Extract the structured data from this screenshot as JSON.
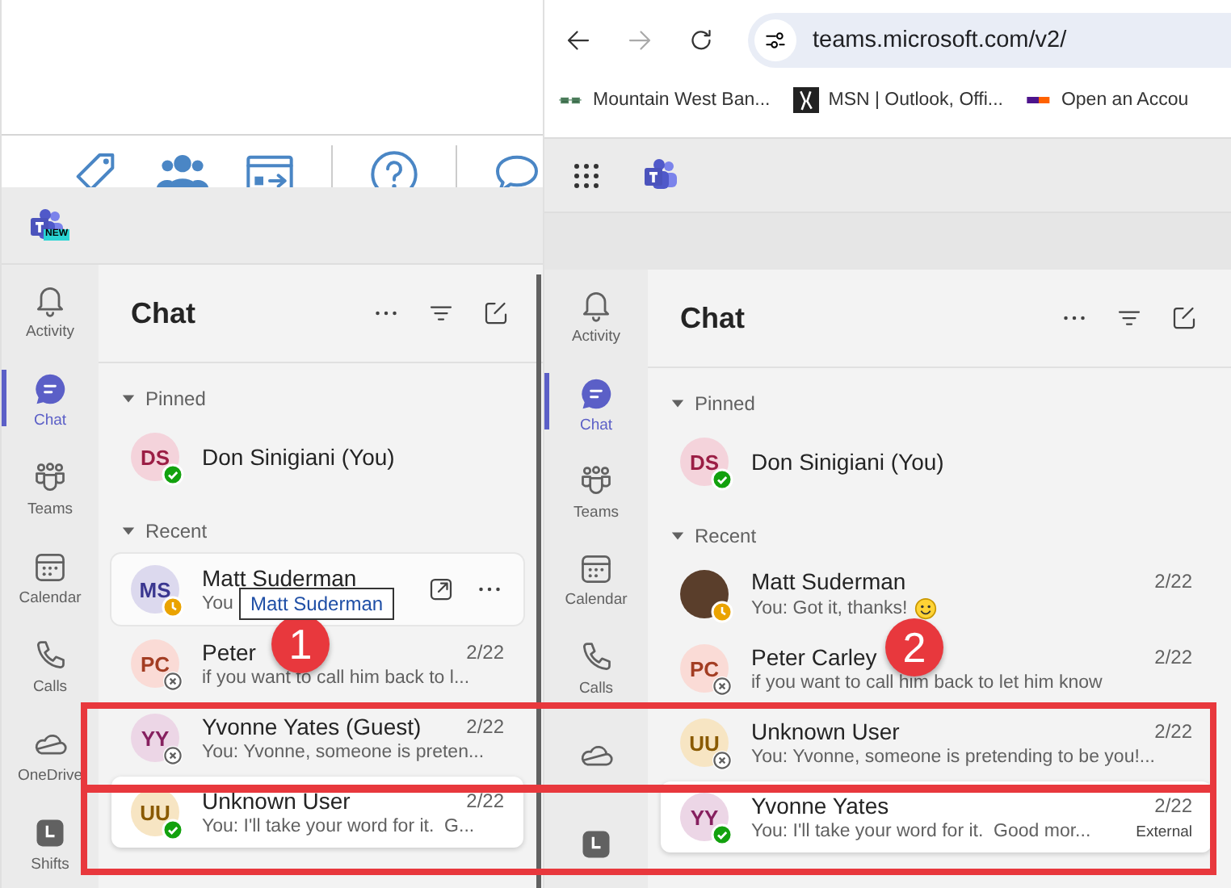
{
  "panes": [
    {
      "top": {
        "kind": "toolbar"
      },
      "app_bar": {
        "launcher": false,
        "logo_badge": "NEW"
      },
      "rail": [
        {
          "kind": "activity",
          "label": "Activity",
          "selected": false
        },
        {
          "kind": "chat",
          "label": "Chat",
          "selected": true
        },
        {
          "kind": "teams",
          "label": "Teams",
          "selected": false
        },
        {
          "kind": "calendar",
          "label": "Calendar",
          "selected": false
        },
        {
          "kind": "calls",
          "label": "Calls",
          "selected": false
        },
        {
          "kind": "onedrive",
          "label": "OneDrive",
          "selected": false
        },
        {
          "kind": "shifts",
          "label": "Shifts",
          "selected": false
        }
      ],
      "title": "Chat",
      "sections": [
        {
          "label": "Pinned",
          "expanded": true,
          "chats": [
            {
              "initials": "DS",
              "color": "#f4d3db",
              "name": "Don Sinigiani (You)",
              "presence": {
                "kind": "available"
              },
              "hovered": false,
              "selected": false
            }
          ]
        },
        {
          "label": "Recent",
          "expanded": true,
          "chats": [
            {
              "initials": "MS",
              "color": "#dcd9ee",
              "name": "Matt Suderman",
              "preview": "You",
              "presence": {
                "kind": "away"
              },
              "hovered": true,
              "selected": false,
              "tooltip": "Matt Suderman"
            },
            {
              "initials": "PC",
              "color": "#fadbd6",
              "name": "Peter",
              "date": "2/22",
              "preview": "if you want to call him back to l...",
              "presence": {
                "kind": "offline"
              },
              "hovered": false,
              "selected": false
            },
            {
              "initials": "YY",
              "color": "#ecd6e6",
              "name": "Yvonne Yates (Guest)",
              "date": "2/22",
              "preview": "You: Yvonne, someone is preten...",
              "presence": {
                "kind": "offline"
              },
              "hovered": false,
              "selected": false
            },
            {
              "initials": "UU",
              "color": "#f7e5c3",
              "name": "Unknown User",
              "date": "2/22",
              "preview": "You: I'll take your word for it.  G...",
              "presence": {
                "kind": "available"
              },
              "hovered": false,
              "selected": true
            }
          ]
        }
      ]
    },
    {
      "top": {
        "kind": "browser",
        "url": "teams.microsoft.com/v2/",
        "bookmarks": [
          {
            "kind": "bank",
            "label": "Mountain West Ban..."
          },
          {
            "kind": "msn",
            "label": "MSN | Outlook, Offi..."
          },
          {
            "kind": "fedex",
            "label": "Open an Accou"
          }
        ]
      },
      "app_bar": {
        "launcher": true
      },
      "rail": [
        {
          "kind": "activity",
          "label": "Activity",
          "selected": false
        },
        {
          "kind": "chat",
          "label": "Chat",
          "selected": true
        },
        {
          "kind": "teams",
          "label": "Teams",
          "selected": false
        },
        {
          "kind": "calendar",
          "label": "Calendar",
          "selected": false
        },
        {
          "kind": "calls",
          "label": "Calls",
          "selected": false
        },
        {
          "kind": "onedrive",
          "selected": false
        },
        {
          "kind": "shifts",
          "selected": false
        }
      ],
      "title": "Chat",
      "sections": [
        {
          "label": "Pinned",
          "expanded": true,
          "chats": [
            {
              "initials": "DS",
              "color": "#f4d3db",
              "name": "Don Sinigiani (You)",
              "presence": {
                "kind": "available"
              },
              "hovered": false,
              "selected": false
            }
          ]
        },
        {
          "label": "Recent",
          "expanded": true,
          "chats": [
            {
              "photo": true,
              "name": "Matt Suderman",
              "date": "2/22",
              "preview": "You: Got it, thanks!",
              "smiley": true,
              "presence": {
                "kind": "away"
              },
              "hovered": false,
              "selected": false
            },
            {
              "initials": "PC",
              "color": "#fadbd6",
              "name": "Peter Carley",
              "date": "2/22",
              "preview": "if you want to call him back to let him know",
              "presence": {
                "kind": "offline"
              },
              "hovered": false,
              "selected": false
            },
            {
              "initials": "UU",
              "color": "#f7e5c3",
              "name": "Unknown User",
              "date": "2/22",
              "preview": "You: Yvonne, someone is pretending to be you!...",
              "presence": {
                "kind": "offline"
              },
              "hovered": false,
              "selected": false
            },
            {
              "initials": "YY",
              "color": "#ecd6e6",
              "name": "Yvonne Yates",
              "date": "2/22",
              "preview": "You: I'll take your word for it.  Good mor...",
              "tag": "External",
              "presence": {
                "kind": "available"
              },
              "hovered": false,
              "selected": true
            }
          ]
        }
      ]
    }
  ],
  "callouts": [
    {
      "label": "1"
    },
    {
      "label": "2"
    }
  ]
}
